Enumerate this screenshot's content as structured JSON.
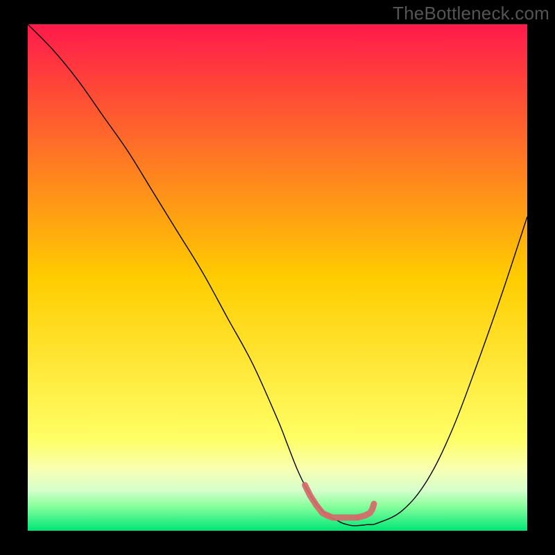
{
  "watermark": "TheBottleneck.com",
  "chart_data": {
    "type": "line",
    "title": "",
    "xlabel": "",
    "ylabel": "",
    "xlim": [
      0,
      100
    ],
    "ylim": [
      0,
      100
    ],
    "background_gradient": {
      "stops": [
        {
          "pos": 0.0,
          "color": "#ff1a4b"
        },
        {
          "pos": 0.5,
          "color": "#ffcc00"
        },
        {
          "pos": 0.82,
          "color": "#ffff66"
        },
        {
          "pos": 0.88,
          "color": "#f7ffb3"
        },
        {
          "pos": 0.92,
          "color": "#d6ffcc"
        },
        {
          "pos": 0.95,
          "color": "#8cff9e"
        },
        {
          "pos": 1.0,
          "color": "#00e676"
        }
      ]
    },
    "series": [
      {
        "name": "bottleneck-curve",
        "color": "#000000",
        "width": 1.4,
        "x": [
          0,
          5,
          10,
          15,
          20,
          25,
          30,
          35,
          40,
          45,
          50,
          52,
          54,
          56,
          58,
          60,
          62,
          63,
          64,
          65,
          66,
          68,
          70,
          75,
          80,
          85,
          90,
          95,
          100
        ],
        "y": [
          100,
          95,
          89,
          82,
          75,
          67,
          59,
          51,
          42,
          33,
          22,
          17,
          12,
          8,
          5,
          3,
          2,
          1.5,
          1.2,
          1.0,
          1.0,
          1.2,
          1.5,
          4,
          10,
          20,
          33,
          47,
          62
        ]
      }
    ],
    "marker_segments": [
      {
        "name": "optimal-range-marker",
        "color": "#d46a6a",
        "width": 9,
        "linecap": "round",
        "points_x": [
          55.5,
          56.5,
          57.8,
          59.0,
          60.0,
          61.0,
          66.0,
          67.5,
          68.5,
          69.0,
          69.3
        ],
        "points_y": [
          9.0,
          7.0,
          5.0,
          3.5,
          3.0,
          2.6,
          2.6,
          3.0,
          3.5,
          4.3,
          5.3
        ]
      }
    ]
  }
}
